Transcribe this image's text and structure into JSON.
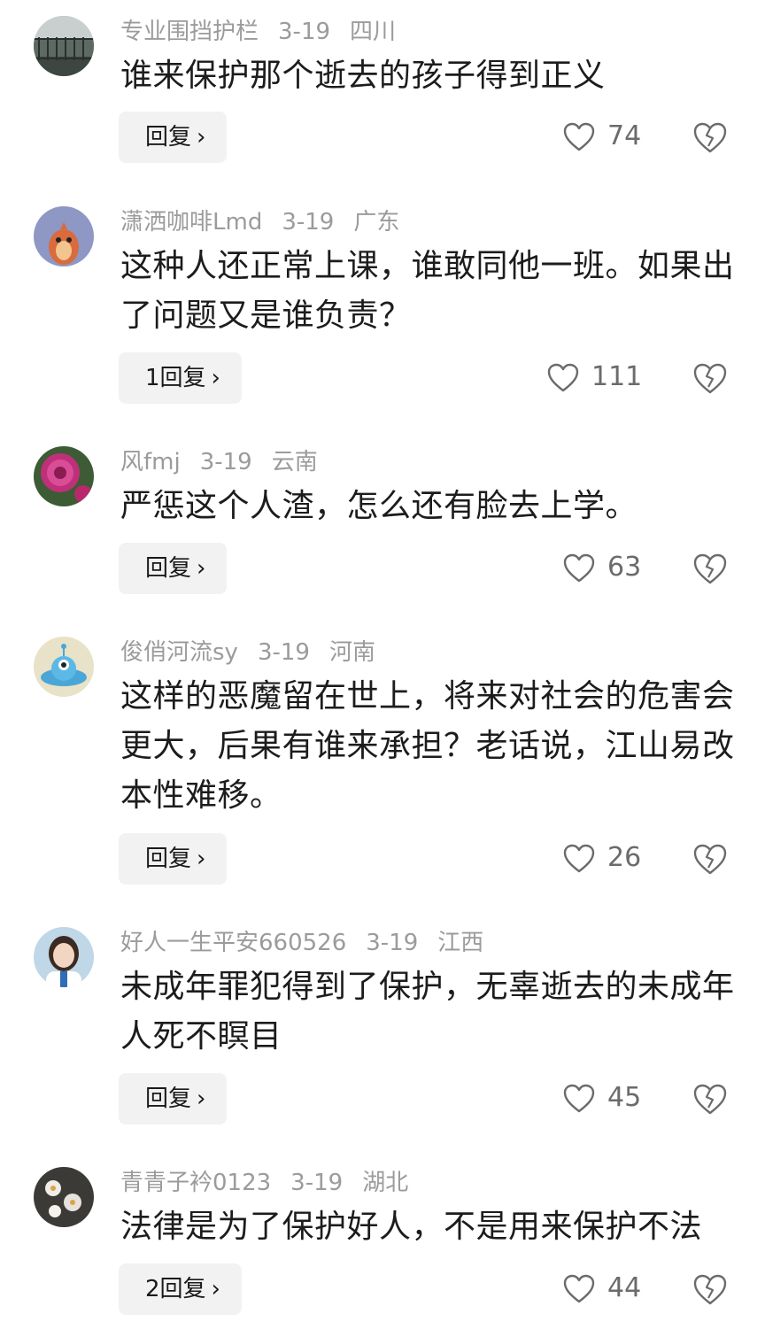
{
  "comments": [
    {
      "username": "专业围挡护栏",
      "date": "3-19",
      "location": "四川",
      "text": "谁来保护那个逝去的孩子得到正义",
      "reply_label": "回复",
      "likes": "74",
      "avatar_icon": "railing-photo-avatar"
    },
    {
      "username": "潇洒咖啡Lmd",
      "date": "3-19",
      "location": "广东",
      "text": "这种人还正常上课，谁敢同他一班。如果出了问题又是谁负责？",
      "reply_label": "1回复",
      "likes": "111",
      "avatar_icon": "cartoon-creature-avatar"
    },
    {
      "username": "风fmj",
      "date": "3-19",
      "location": "云南",
      "text": "严惩这个人渣，怎么还有脸去上学。",
      "reply_label": "回复",
      "likes": "63",
      "avatar_icon": "flower-avatar"
    },
    {
      "username": "俊俏河流sy",
      "date": "3-19",
      "location": "河南",
      "text": "这样的恶魔留在世上，将来对社会的危害会更大，后果有谁来承担？老话说，江山易改本性难移。",
      "reply_label": "回复",
      "likes": "26",
      "avatar_icon": "alien-ufo-avatar"
    },
    {
      "username": "好人一生平安660526",
      "date": "3-19",
      "location": "江西",
      "text": "未成年罪犯得到了保护，无辜逝去的未成年人死不瞑目",
      "reply_label": "回复",
      "likes": "45",
      "avatar_icon": "girl-portrait-avatar"
    },
    {
      "username": "青青子衿0123",
      "date": "3-19",
      "location": "湖北",
      "text": "法律是为了保护好人，不是用来保护不法",
      "reply_label": "2回复",
      "likes": "44",
      "avatar_icon": "white-flowers-avatar"
    }
  ],
  "colors": {
    "meta_text": "#9b9b9b",
    "body_text": "#1c1c1c",
    "reply_bg": "#f2f2f2",
    "icon_stroke": "#6b6b6b"
  },
  "icons": {
    "like": "heart-outline-icon",
    "dislike": "broken-heart-icon",
    "reply_chevron": "chevron-right-icon"
  }
}
